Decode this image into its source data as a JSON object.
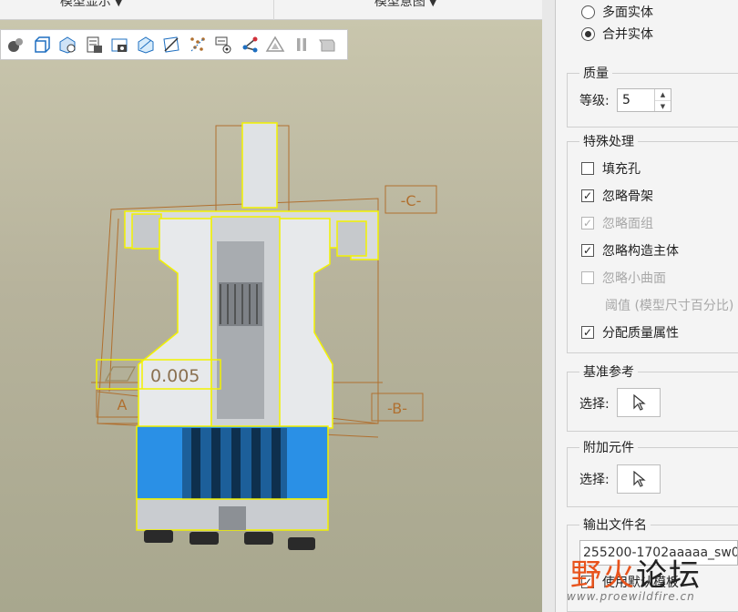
{
  "ribbon": {
    "model_display": "模型显示",
    "model_intent": "模型意图"
  },
  "toolbar": {
    "icons": [
      "shading-icon",
      "box-view-icon",
      "saved-view-icon",
      "layers-icon",
      "snapshot-icon",
      "transparent-icon",
      "section-icon",
      "spin-center-icon",
      "annotation-display-icon",
      "csys-display-icon",
      "datum-display-icon",
      "pause-icon",
      "repaint-icon"
    ]
  },
  "model": {
    "annotation_value": "0.005",
    "datum_a": "A",
    "datum_b": "-B-",
    "datum_c": "-C-",
    "colors": {
      "housing": "#e4e6e8",
      "blue_band": "#2a90e6",
      "outline": "#f2f200",
      "datum_frame": "#b07030"
    }
  },
  "panel": {
    "options": {
      "multi_surface_solid": "多面实体",
      "merged_solid": "合并实体",
      "selected": "合并实体"
    },
    "quality": {
      "title": "质量",
      "level_label": "等级:",
      "level_value": "5"
    },
    "special": {
      "title": "特殊处理",
      "items": [
        {
          "label": "填充孔",
          "checked": false,
          "disabled": false
        },
        {
          "label": "忽略骨架",
          "checked": true,
          "disabled": false
        },
        {
          "label": "忽略面组",
          "checked": true,
          "disabled": true
        },
        {
          "label": "忽略构造主体",
          "checked": true,
          "disabled": false
        },
        {
          "label": "忽略小曲面",
          "checked": false,
          "disabled": true
        },
        {
          "label": "分配质量属性",
          "checked": true,
          "disabled": false
        }
      ],
      "threshold_label": "阈值 (模型尺寸百分比)"
    },
    "datum_ref": {
      "title": "基准参考",
      "select_label": "选择:"
    },
    "add_component": {
      "title": "附加元件",
      "select_label": "选择:"
    },
    "output_name": {
      "title": "输出文件名",
      "value": "255200-1702aaaaa_sw0",
      "use_default_template": "使用默认模板",
      "use_default_checked": true
    }
  },
  "watermark": {
    "logo_part1": "野火",
    "logo_part2": "论坛",
    "url": "www.proewildfire.cn"
  }
}
